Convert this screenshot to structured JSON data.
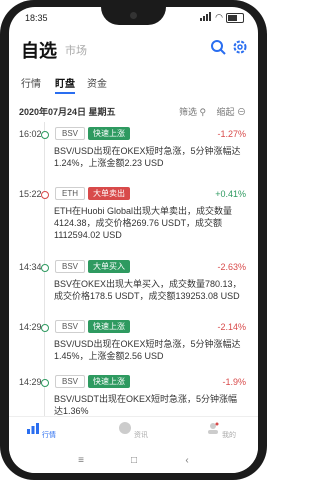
{
  "status_bar": {
    "time": "18:35"
  },
  "header": {
    "title": "自选",
    "subtitle": "市场"
  },
  "tabs": [
    {
      "label": "行情",
      "active": false
    },
    {
      "label": "盯盘",
      "active": true
    },
    {
      "label": "资金",
      "active": false
    }
  ],
  "datebar": {
    "date": "2020年07月24日 星期五",
    "filter": "筛选",
    "collapse": "缩起"
  },
  "entries": [
    {
      "time": "16:02",
      "coin": "BSV",
      "badge": "快速上涨",
      "badge_color": "green",
      "change": "-1.27%",
      "change_color": "red",
      "text": "BSV/USD出现在OKEX短时急涨，5分钟涨幅达1.24%，上涨金额2.23 USD"
    },
    {
      "time": "15:22",
      "coin": "ETH",
      "badge": "大单卖出",
      "badge_color": "red",
      "change": "+0.41%",
      "change_color": "green",
      "text": "ETH在Huobi Global出现大单卖出，成交数量4124.38，成交价格269.76 USDT，成交额1112594.02 USD"
    },
    {
      "time": "14:34",
      "coin": "BSV",
      "badge": "大单买入",
      "badge_color": "green",
      "change": "-2.63%",
      "change_color": "red",
      "text": "BSV在OKEX出现大单买入，成交数量780.13，成交价格178.5 USDT，成交额139253.08 USD"
    },
    {
      "time": "14:29",
      "coin": "BSV",
      "badge": "快速上涨",
      "badge_color": "green",
      "change": "-2.14%",
      "change_color": "red",
      "text": "BSV/USD出现在OKEX短时急涨，5分钟涨幅达1.45%，上涨金额2.56 USD"
    },
    {
      "time": "14:29",
      "coin": "BSV",
      "badge": "快速上涨",
      "badge_color": "green",
      "change": "-1.9%",
      "change_color": "red",
      "text": "BSV/USDT出现在OKEX短时急涨，5分钟涨幅达1.36%"
    }
  ],
  "bottom_nav": [
    {
      "label": "行情",
      "icon": "chart-icon",
      "active": true
    },
    {
      "label": "资讯",
      "icon": "news-icon",
      "active": false
    },
    {
      "label": "我的",
      "icon": "user-icon",
      "active": false
    }
  ],
  "colors": {
    "accent": "#2a6ef0",
    "up_green": "#2e9a60",
    "down_red": "#d84a4a"
  }
}
